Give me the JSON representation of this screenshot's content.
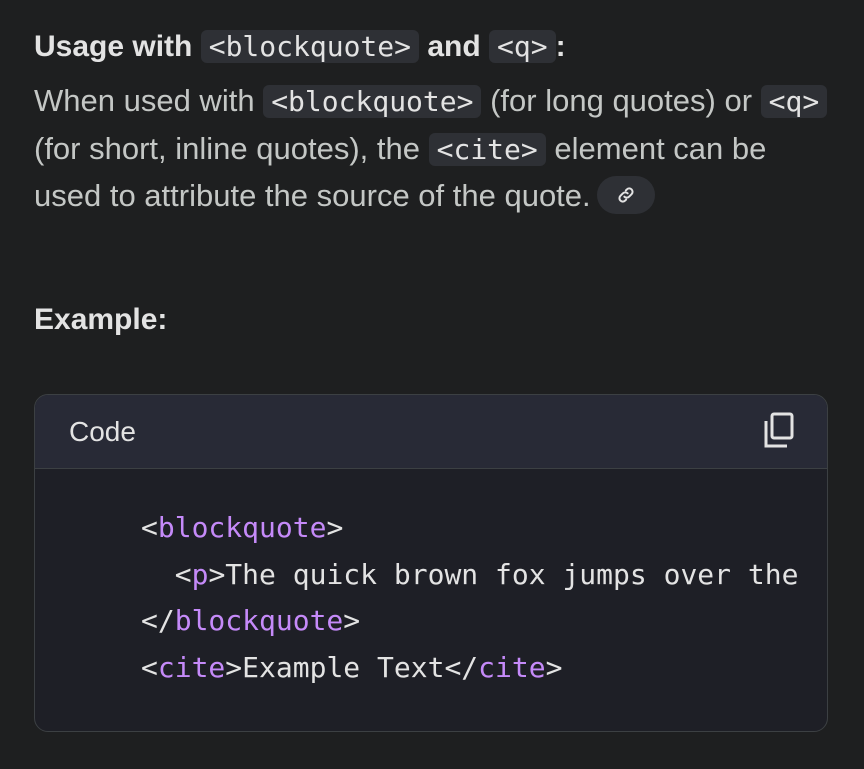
{
  "heading": {
    "prefix": "Usage with",
    "code1": "<blockquote>",
    "joiner": "and",
    "code2": "<q>",
    "suffix": ":"
  },
  "paragraph": {
    "part1": "When used with",
    "code1": "<blockquote>",
    "part2": "(for long quotes) or",
    "code2": "<q>",
    "part3": "(for short, inline quotes), the",
    "code3": "<cite>",
    "part4": "element can be used to attribute the source of the quote."
  },
  "icons": {
    "source_link": "link-icon",
    "copy": "copy-icon"
  },
  "example_title": "Example:",
  "code_block": {
    "language_label": "Code",
    "lines": {
      "l1_open": "<",
      "l1_tag": "blockquote",
      "l1_close": ">",
      "l2_indent": "  ",
      "l2_open": "<",
      "l2_tag": "p",
      "l2_text": ">The quick brown fox jumps over the",
      "l3_open": "</",
      "l3_tag": "blockquote",
      "l3_close": ">",
      "l4_open": "<",
      "l4_tag": "cite",
      "l4_text": ">Example Text</",
      "l4_tag2": "cite",
      "l4_close": ">"
    }
  },
  "colors": {
    "background": "#1e1f20",
    "inline_code_bg": "#2e3035",
    "code_header_bg": "#282a36",
    "tag_name": "#c58af9"
  }
}
